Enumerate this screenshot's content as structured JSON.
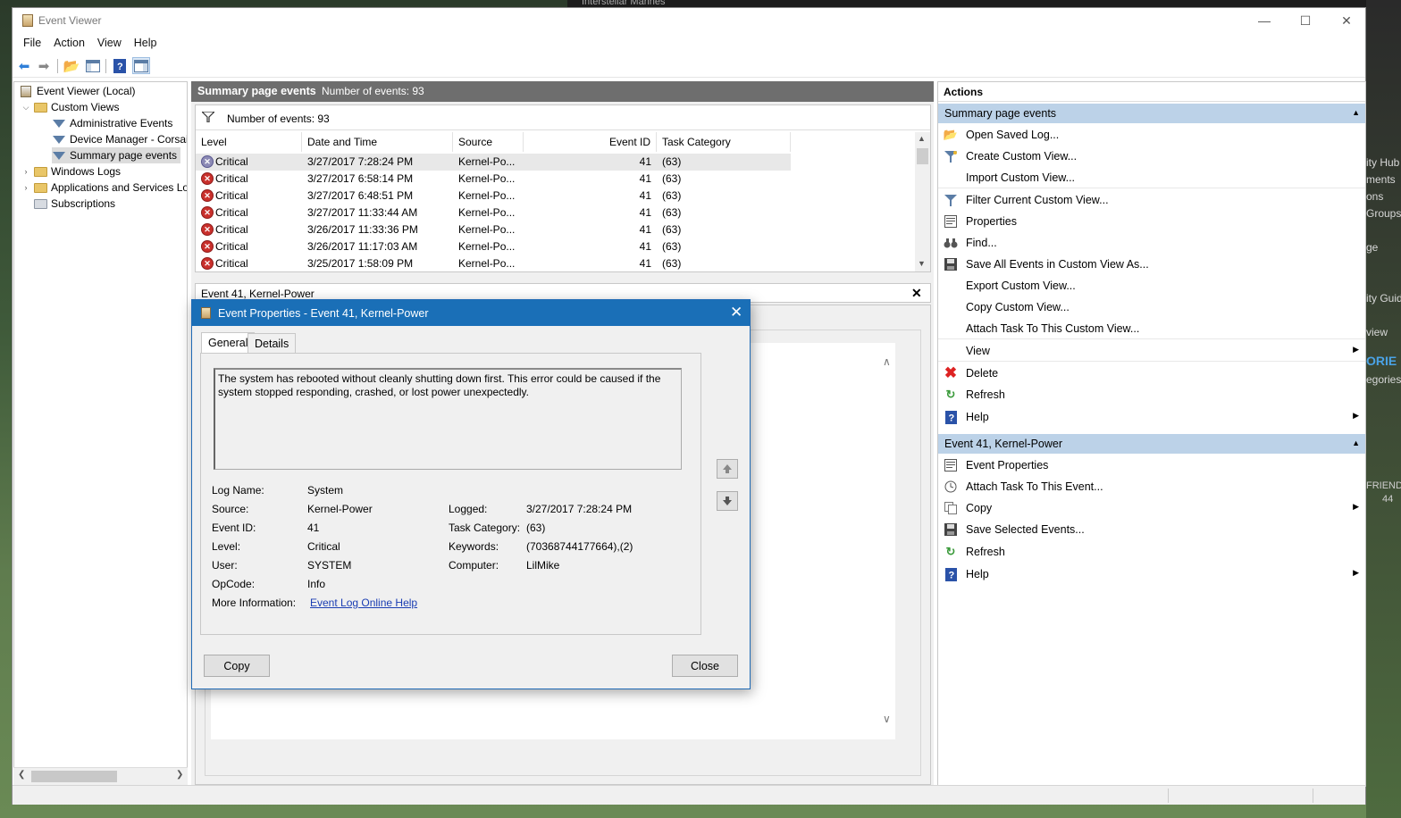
{
  "background": {
    "top_text": "Interstellar Marines",
    "right_fragments": [
      "ity Hub",
      "ments",
      "ons",
      "Groups",
      "ge",
      "ity Guid",
      "view",
      "ORIE",
      "egories...",
      "FRIEND",
      "44"
    ]
  },
  "window": {
    "title": "Event Viewer",
    "controls": {
      "minimize": "—",
      "maximize": "☐",
      "close": "✕"
    }
  },
  "menu": [
    "File",
    "Action",
    "View",
    "Help"
  ],
  "tree": {
    "root": "Event Viewer (Local)",
    "custom_views": "Custom Views",
    "admin_events": "Administrative Events",
    "device_manager": "Device Manager - Corsair",
    "summary_events": "Summary page events",
    "windows_logs": "Windows Logs",
    "app_services": "Applications and Services Lo",
    "subscriptions": "Subscriptions"
  },
  "summary": {
    "title": "Summary page events",
    "count_label": "Number of events: 93",
    "filter_label": "Number of events: 93"
  },
  "columns": [
    "Level",
    "Date and Time",
    "Source",
    "Event ID",
    "Task Category"
  ],
  "events": [
    {
      "level": "Critical",
      "datetime": "3/27/2017 7:28:24 PM",
      "source": "Kernel-Po...",
      "event_id": "41",
      "category": "(63)"
    },
    {
      "level": "Critical",
      "datetime": "3/27/2017 6:58:14 PM",
      "source": "Kernel-Po...",
      "event_id": "41",
      "category": "(63)"
    },
    {
      "level": "Critical",
      "datetime": "3/27/2017 6:48:51 PM",
      "source": "Kernel-Po...",
      "event_id": "41",
      "category": "(63)"
    },
    {
      "level": "Critical",
      "datetime": "3/27/2017 11:33:44 AM",
      "source": "Kernel-Po...",
      "event_id": "41",
      "category": "(63)"
    },
    {
      "level": "Critical",
      "datetime": "3/26/2017 11:33:36 PM",
      "source": "Kernel-Po...",
      "event_id": "41",
      "category": "(63)"
    },
    {
      "level": "Critical",
      "datetime": "3/26/2017 11:17:03 AM",
      "source": "Kernel-Po...",
      "event_id": "41",
      "category": "(63)"
    },
    {
      "level": "Critical",
      "datetime": "3/25/2017 1:58:09 PM",
      "source": "Kernel-Po...",
      "event_id": "41",
      "category": "(63)"
    }
  ],
  "detail": {
    "title": "Event 41, Kernel-Power",
    "close": "✕"
  },
  "actions": {
    "title": "Actions",
    "section1": {
      "title": "Summary page events",
      "items": [
        {
          "label": "Open Saved Log...",
          "icon": "open-folder-icon"
        },
        {
          "label": "Create Custom View...",
          "icon": "filter-new-icon"
        },
        {
          "label": "Import Custom View...",
          "icon": ""
        },
        {
          "label": "Filter Current Custom View...",
          "icon": "filter-icon"
        },
        {
          "label": "Properties",
          "icon": "properties-icon"
        },
        {
          "label": "Find...",
          "icon": "binoculars-icon"
        },
        {
          "label": "Save All Events in Custom View As...",
          "icon": "save-icon"
        },
        {
          "label": "Export Custom View...",
          "icon": ""
        },
        {
          "label": "Copy Custom View...",
          "icon": ""
        },
        {
          "label": "Attach Task To This Custom View...",
          "icon": ""
        },
        {
          "label": "View",
          "icon": ""
        },
        {
          "label": "Delete",
          "icon": "delete-icon"
        },
        {
          "label": "Refresh",
          "icon": "refresh-icon"
        },
        {
          "label": "Help",
          "icon": "help-icon"
        }
      ]
    },
    "section2": {
      "title": "Event 41, Kernel-Power",
      "items": [
        {
          "label": "Event Properties",
          "icon": "event-properties-icon"
        },
        {
          "label": "Attach Task To This Event...",
          "icon": "task-icon"
        },
        {
          "label": "Copy",
          "icon": "copy-icon"
        },
        {
          "label": "Save Selected Events...",
          "icon": "save-icon"
        },
        {
          "label": "Refresh",
          "icon": "refresh-icon"
        },
        {
          "label": "Help",
          "icon": "help-icon"
        }
      ]
    }
  },
  "dialog": {
    "title": "Event Properties - Event 41, Kernel-Power",
    "tabs": [
      "General",
      "Details"
    ],
    "message": "The system has rebooted without cleanly shutting down first. This error could be caused if the system stopped responding, crashed, or lost power unexpectedly.",
    "fields": {
      "log_name_label": "Log Name:",
      "log_name": "System",
      "source_label": "Source:",
      "source": "Kernel-Power",
      "logged_label": "Logged:",
      "logged": "3/27/2017 7:28:24 PM",
      "event_id_label": "Event ID:",
      "event_id": "41",
      "task_category_label": "Task Category:",
      "task_category": "(63)",
      "level_label": "Level:",
      "level": "Critical",
      "keywords_label": "Keywords:",
      "keywords": "(70368744177664),(2)",
      "user_label": "User:",
      "user": "SYSTEM",
      "computer_label": "Computer:",
      "computer": "LilMike",
      "opcode_label": "OpCode:",
      "opcode": "Info",
      "more_info_label": "More Information:",
      "more_info_link": "Event Log Online Help"
    },
    "buttons": {
      "copy": "Copy",
      "close": "Close"
    }
  }
}
